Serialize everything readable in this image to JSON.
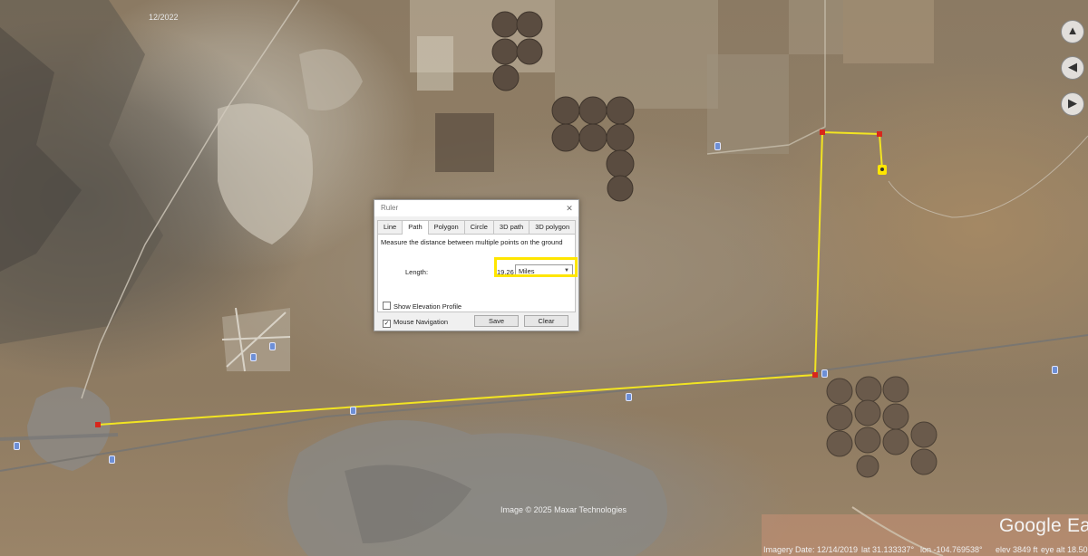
{
  "map": {
    "top_date": "12/2022",
    "attribution": "Image © 2025 Maxar Technologies",
    "logo": "Google Earth",
    "status": {
      "imagery_date": "Imagery Date: 12/14/2019",
      "lat": "lat   31.133337°",
      "lon": "lon -104.769538°",
      "elev": "elev  3849 ft",
      "eye_alt": "eye alt  18.50"
    },
    "nav_icons": [
      "chevron-up-icon",
      "chevron-left-icon",
      "chevron-right-icon"
    ],
    "path_color": "#f2e422"
  },
  "ruler": {
    "title": "Ruler",
    "close_icon": "close-icon",
    "tabs": [
      {
        "label": "Line",
        "active": false
      },
      {
        "label": "Path",
        "active": true
      },
      {
        "label": "Polygon",
        "active": false
      },
      {
        "label": "Circle",
        "active": false
      },
      {
        "label": "3D path",
        "active": false
      },
      {
        "label": "3D polygon",
        "active": false
      }
    ],
    "description": "Measure the distance between multiple points on the ground",
    "length_label": "Length:",
    "length_value": "19.26",
    "unit": "Miles",
    "show_elevation_profile": "Show Elevation Profile",
    "show_elevation_checked": false,
    "mouse_navigation": "Mouse Navigation",
    "mouse_navigation_checked": true,
    "save_label": "Save",
    "clear_label": "Clear",
    "highlight_color": "#ffe600"
  }
}
